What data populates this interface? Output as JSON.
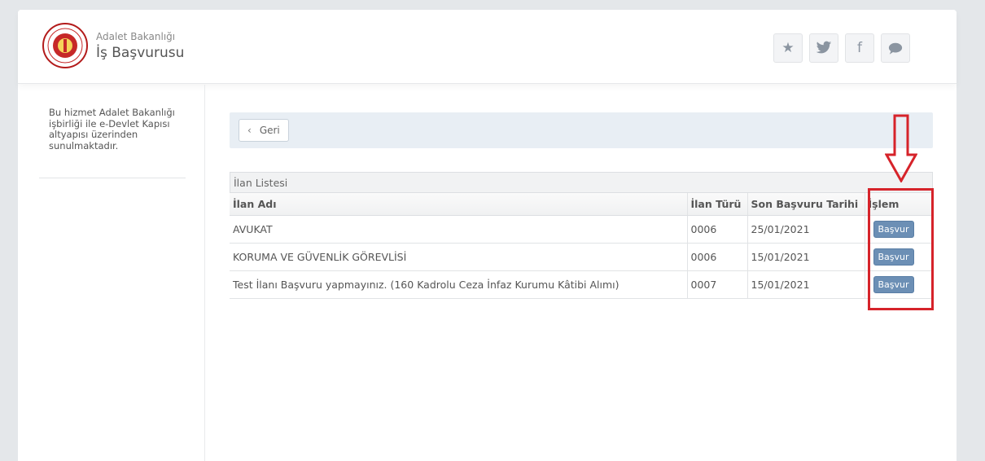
{
  "header": {
    "org_name": "Adalet Bakanlığı",
    "service_title": "İş Başvurusu",
    "logo_icon": "ministry-seal-icon",
    "social_buttons": [
      {
        "icon": "star-icon",
        "glyph": "★"
      },
      {
        "icon": "twitter-icon",
        "glyph": "🐦"
      },
      {
        "icon": "facebook-icon",
        "glyph": "f"
      },
      {
        "icon": "comment-icon",
        "glyph": "💬"
      }
    ]
  },
  "sidebar": {
    "info_text": "Bu hizmet Adalet Bakanlığı işbirliği ile e-Devlet Kapısı altyapısı üzerinden sunulmaktadır."
  },
  "toolbar": {
    "back_label": "Geri",
    "back_icon": "chevron-left-icon"
  },
  "listing": {
    "title": "İlan Listesi",
    "columns": [
      "İlan Adı",
      "İlan Türü",
      "Son Başvuru Tarihi",
      "İşlem"
    ],
    "rows": [
      {
        "name": "AVUKAT",
        "type": "0006",
        "deadline": "25/01/2021",
        "action": "Başvur"
      },
      {
        "name": "KORUMA VE GÜVENLİK GÖREVLİSİ",
        "type": "0006",
        "deadline": "15/01/2021",
        "action": "Başvur"
      },
      {
        "name": "Test İlanı Başvuru yapmayınız. (160 Kadrolu Ceza İnfaz Kurumu Kâtibi Alımı)",
        "type": "0007",
        "deadline": "15/01/2021",
        "action": "Başvur"
      }
    ]
  },
  "annotation": {
    "color": "#d6232a"
  }
}
